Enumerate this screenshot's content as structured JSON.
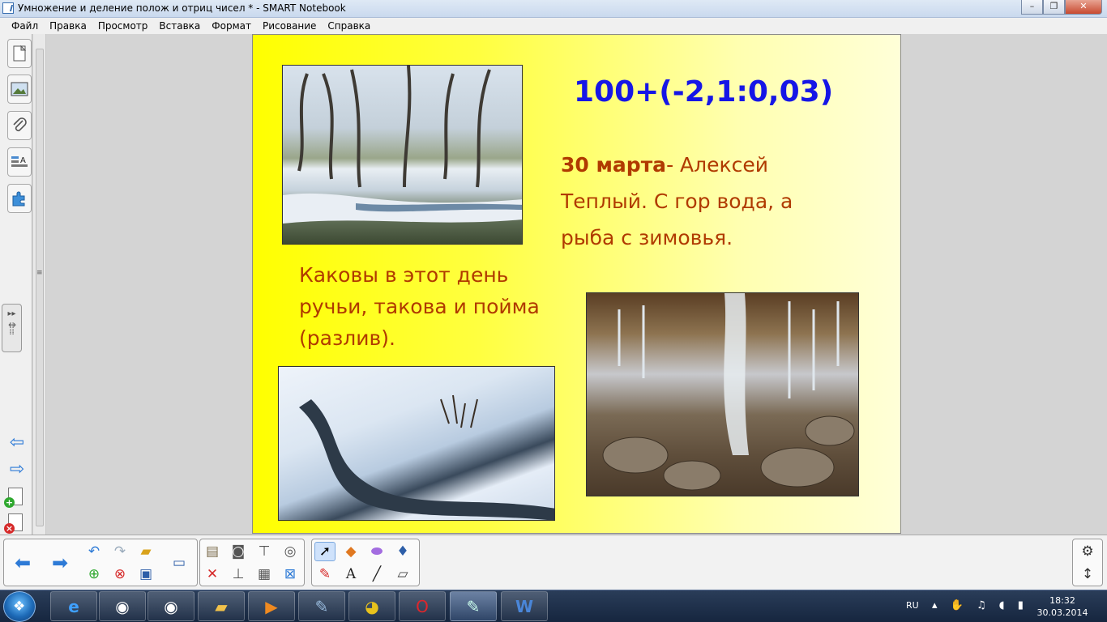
{
  "window": {
    "title": "Умножение и деление полож и отриц чисел * - SMART Notebook",
    "buttons": [
      "–",
      "❐",
      "✕"
    ]
  },
  "menu": [
    "Файл",
    "Правка",
    "Просмотр",
    "Вставка",
    "Формат",
    "Рисование",
    "Справка"
  ],
  "slide": {
    "formula": "100+(-2,1:0,03)",
    "quote_bold": "30 марта",
    "quote_rest": "- Алексей Теплый. С гор вода, а рыба с зимовья.",
    "caption": "Каковы в этот день ручьи, такова и пойма (разлив).",
    "colors": {
      "formula": "#1616e6",
      "text": "#b03a00",
      "background": "#ffff00"
    }
  },
  "toolbar": {
    "icons": [
      "prev-page-icon",
      "next-page-icon",
      "undo-icon",
      "redo-icon",
      "open-icon",
      "add-page-icon",
      "delete-page-icon",
      "save-icon",
      "display-icon",
      "paste-icon",
      "screen-capture-icon",
      "screen-shade-icon",
      "clear-icon",
      "document-camera-icon",
      "table-icon",
      "select-icon",
      "shapes-icon",
      "eraser-icon",
      "fill-icon",
      "pens-icon",
      "text-icon",
      "line-icon",
      "magic-pen-icon",
      "settings-icon",
      "move-toolbar-icon"
    ]
  },
  "taskbar": {
    "lang": "RU",
    "time": "18:32",
    "date": "30.03.2014"
  }
}
